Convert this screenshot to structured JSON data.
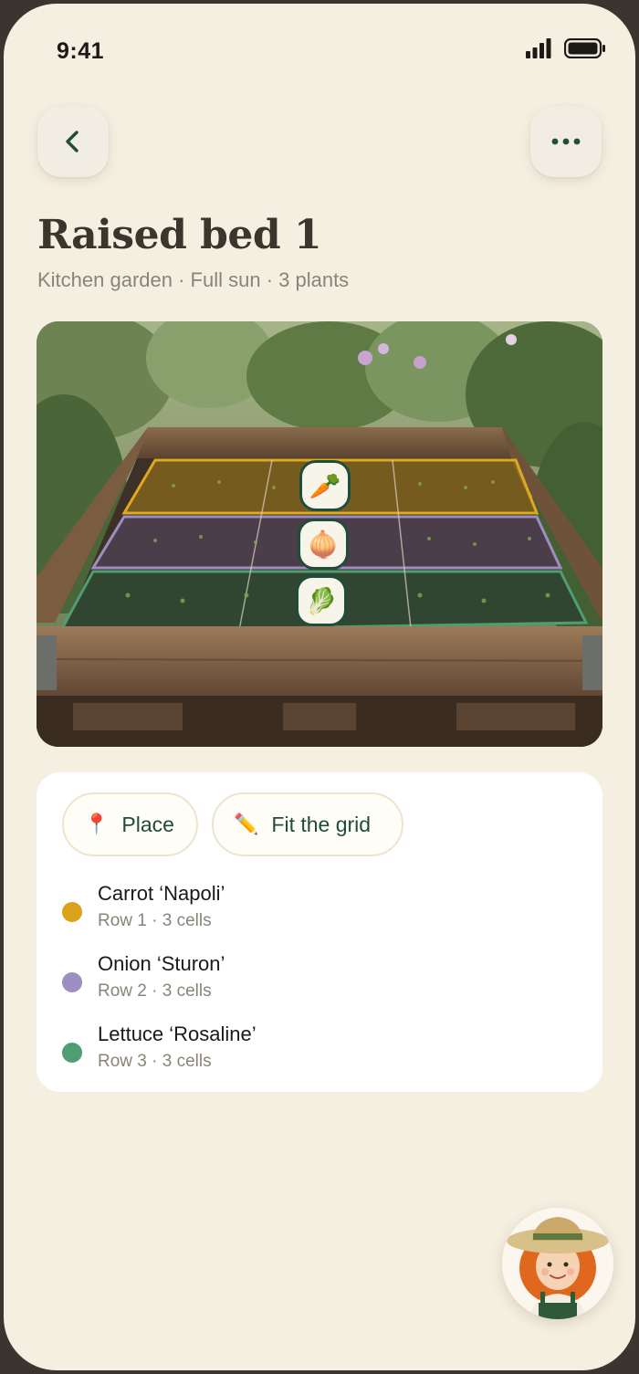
{
  "status_bar": {
    "time": "9:41"
  },
  "header": {
    "title": "Raised bed 1",
    "subtitle": "Kitchen garden · Full sun · 3 plants"
  },
  "photo": {
    "markers": [
      {
        "icon": "carrot-icon",
        "glyph": "🥕"
      },
      {
        "icon": "onion-icon",
        "glyph": "🧅"
      },
      {
        "icon": "lettuce-icon",
        "glyph": "🥬"
      }
    ]
  },
  "actions": {
    "place": {
      "icon": "pin-icon",
      "glyph": "📍",
      "label": "Place"
    },
    "fit": {
      "icon": "pencil-icon",
      "glyph": "✏️",
      "label": "Fit the grid"
    }
  },
  "plants": [
    {
      "name": "Carrot ‘Napoli’",
      "meta": "Row 1 · 3 cells",
      "color": "#d9a21a"
    },
    {
      "name": "Onion ‘Sturon’",
      "meta": "Row 2 · 3 cells",
      "color": "#9c8ec0"
    },
    {
      "name": "Lettuce ‘Rosaline’",
      "meta": "Row 3 · 3 cells",
      "color": "#4f9e72"
    }
  ],
  "colors": {
    "accent": "#1f4d3a",
    "background": "#f5efe1",
    "row1": "#d9a21a",
    "row2": "#8e7fb8",
    "row3": "#4f9e72"
  }
}
